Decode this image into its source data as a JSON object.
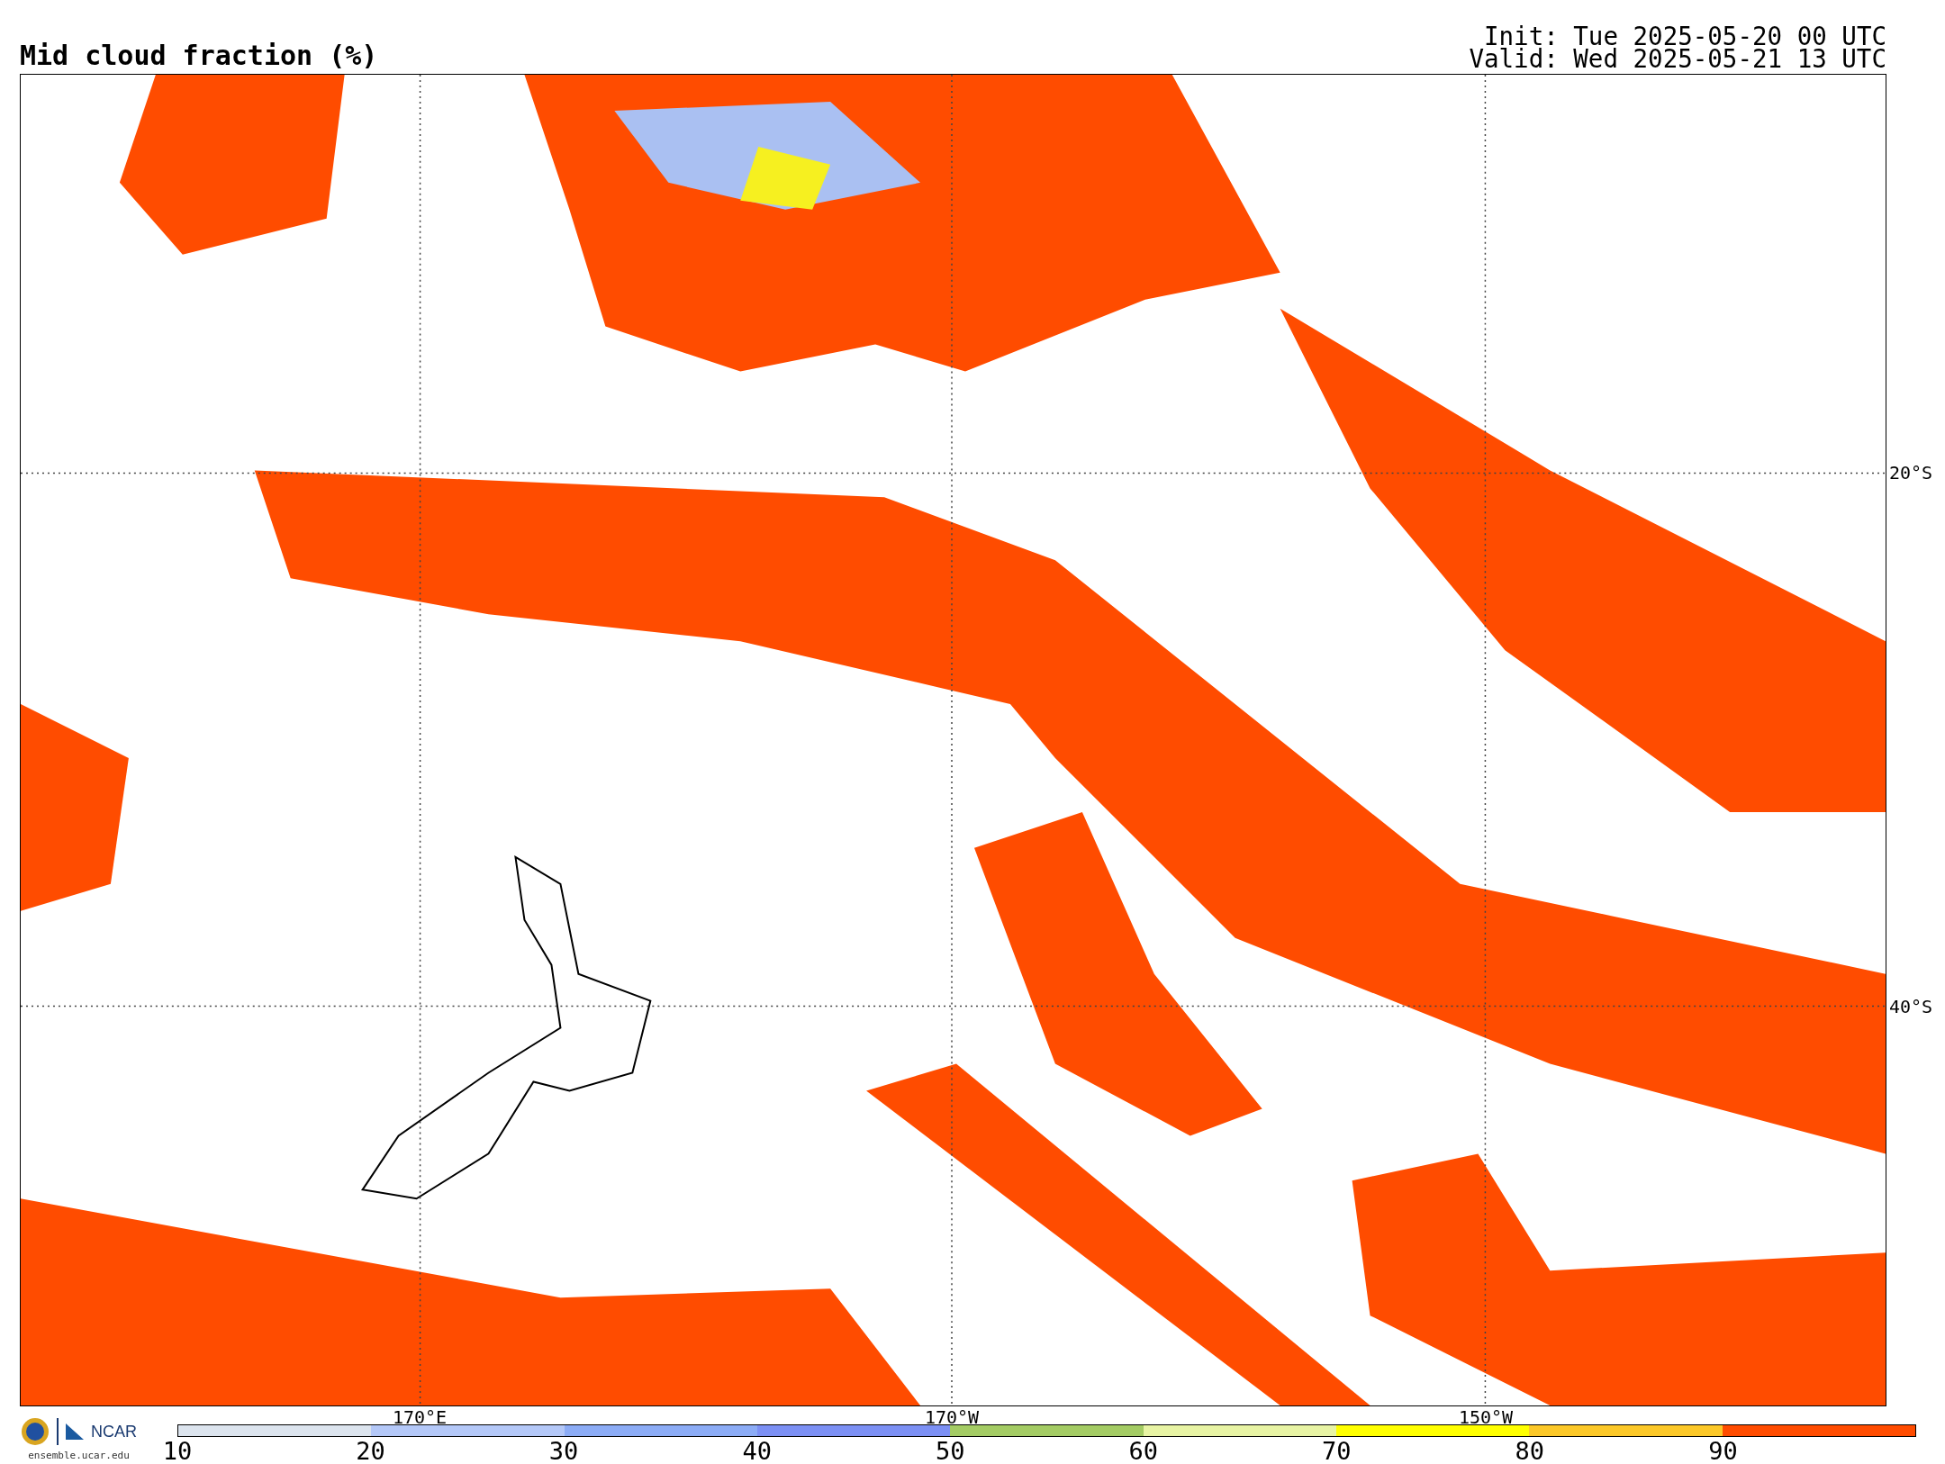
{
  "title": "Mid cloud fraction (%)",
  "init": "Init: Tue 2025-05-20 00 UTC",
  "valid": "Valid: Wed 2025-05-21 13 UTC",
  "map": {
    "longitude_labels": [
      "170°E",
      "170°W",
      "150°W"
    ],
    "latitude_labels": [
      "20°S",
      "40°S"
    ]
  },
  "logo": {
    "wordmark": "NCAR",
    "url": "ensemble.ucar.edu"
  },
  "colorbar": {
    "segments": [
      {
        "label": "10",
        "color": "#dce4ee"
      },
      {
        "label": "20",
        "color": "#b4c8f8"
      },
      {
        "label": "30",
        "color": "#8cacf6"
      },
      {
        "label": "40",
        "color": "#7c90f4"
      },
      {
        "label": "50",
        "color": "#a4cc64"
      },
      {
        "label": "60",
        "color": "#e8f4a4"
      },
      {
        "label": "70",
        "color": "#ffff00"
      },
      {
        "label": "80",
        "color": "#fcc828"
      },
      {
        "label": "90",
        "color": "#ff4c00"
      }
    ]
  }
}
